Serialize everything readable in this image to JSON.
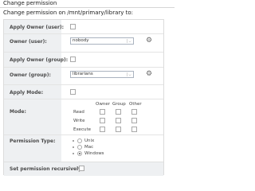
{
  "window": {
    "tab_title": "Change permission"
  },
  "header": {
    "text": "Change permission on /mnt/primary/library to:"
  },
  "form": {
    "apply_owner_user_label": "Apply Owner (user):",
    "owner_user_label": "Owner (user):",
    "owner_user_value": "nobody",
    "apply_owner_group_label": "Apply Owner (group):",
    "owner_group_label": "Owner (group):",
    "owner_group_value": "librarians",
    "apply_mode_label": "Apply Mode:",
    "mode_label": "Mode:",
    "mode_headers": [
      "Owner",
      "Group",
      "Other"
    ],
    "mode_rows": [
      "Read",
      "Write",
      "Execute"
    ],
    "permission_type_label": "Permission Type:",
    "permission_types": [
      {
        "label": "Unix",
        "selected": false
      },
      {
        "label": "Mac",
        "selected": false
      },
      {
        "label": "Windows",
        "selected": true
      }
    ],
    "recursive_label": "Set permission recursively:"
  }
}
